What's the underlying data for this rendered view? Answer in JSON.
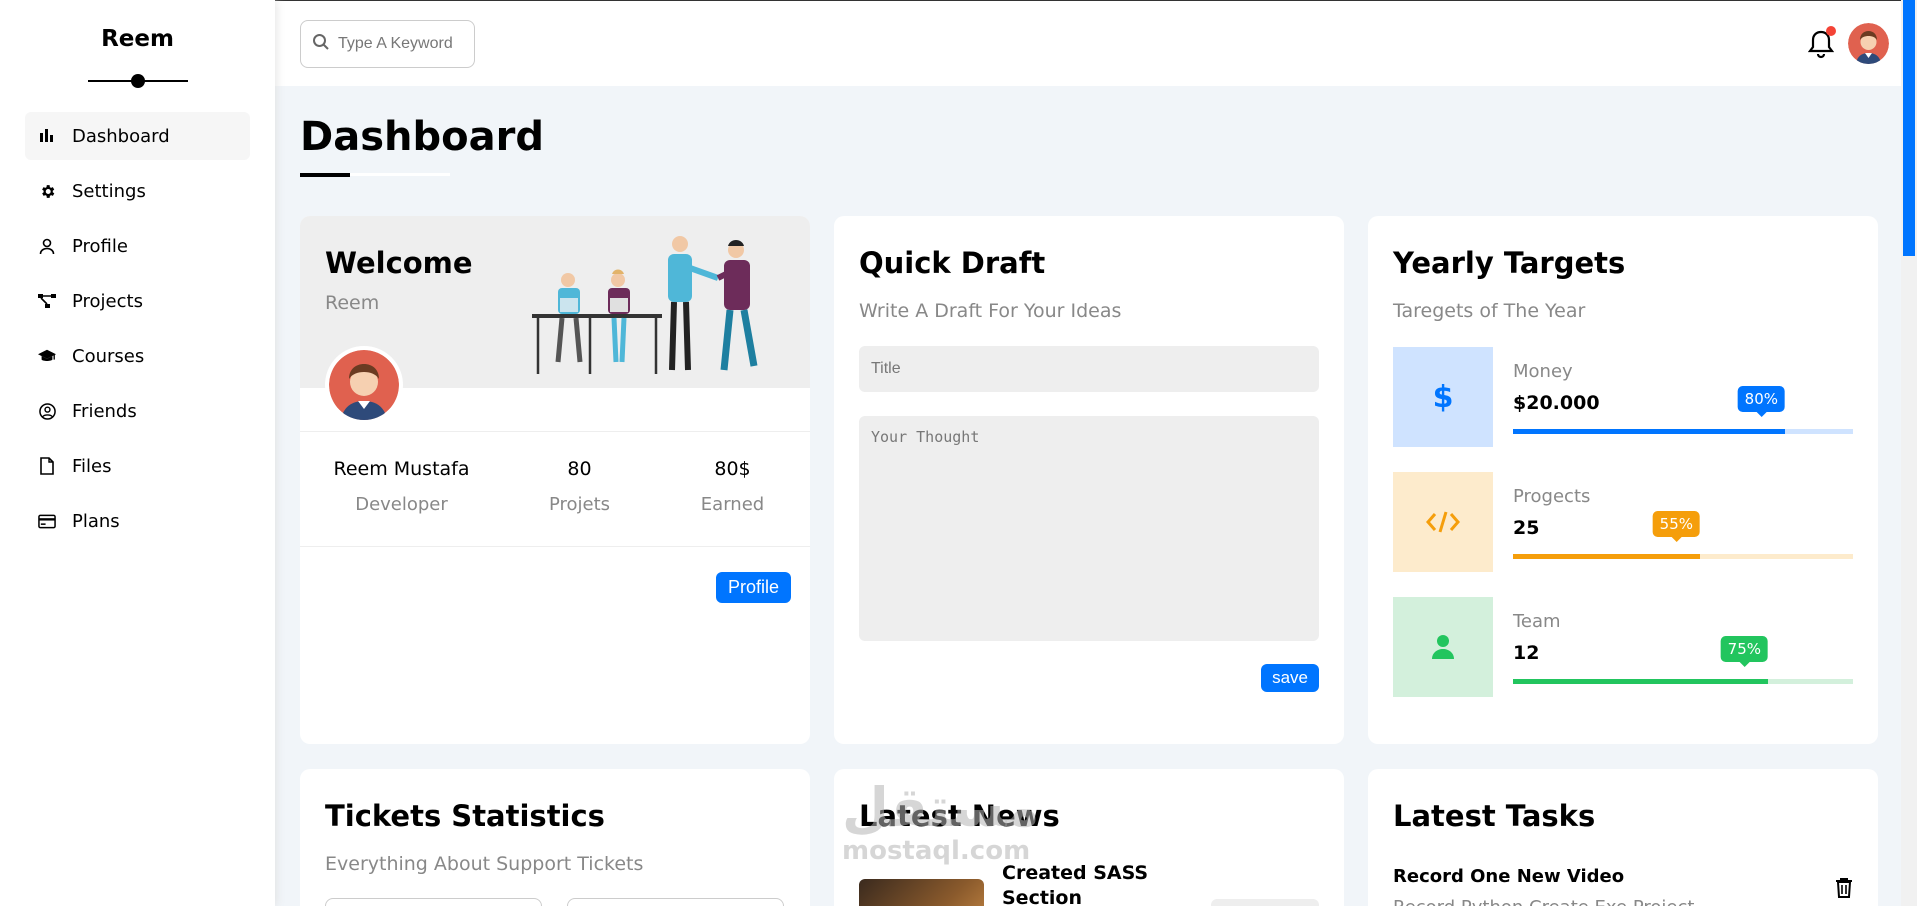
{
  "sidebar": {
    "brand": "Reem",
    "items": [
      {
        "label": "Dashboard",
        "icon": "chart-bar-icon",
        "active": true
      },
      {
        "label": "Settings",
        "icon": "gear-icon"
      },
      {
        "label": "Profile",
        "icon": "user-icon"
      },
      {
        "label": "Projects",
        "icon": "diagram-icon"
      },
      {
        "label": "Courses",
        "icon": "graduation-cap-icon"
      },
      {
        "label": "Friends",
        "icon": "user-circle-icon"
      },
      {
        "label": "Files",
        "icon": "file-icon"
      },
      {
        "label": "Plans",
        "icon": "credit-card-icon"
      }
    ]
  },
  "header": {
    "search_placeholder": "Type A Keyword"
  },
  "page": {
    "title": "Dashboard"
  },
  "welcome": {
    "title": "Welcome",
    "subtitle": "Reem",
    "stats": [
      {
        "value": "Reem Mustafa",
        "label": "Developer"
      },
      {
        "value": "80",
        "label": "Projets"
      },
      {
        "value": "80$",
        "label": "Earned"
      }
    ],
    "button": "Profile"
  },
  "quick_draft": {
    "title": "Quick Draft",
    "subtitle": "Write A Draft For Your Ideas",
    "title_placeholder": "Title",
    "thought_placeholder": "Your Thought",
    "button": "save"
  },
  "yearly_targets": {
    "title": "Yearly Targets",
    "subtitle": "Taregets of The Year",
    "targets": [
      {
        "label": "Money",
        "value": "$20.000",
        "percent": 80,
        "badge": "80%",
        "icon": "dollar-icon",
        "color": "#0075ff",
        "bg": "#cfe3ff",
        "track": "#cfe3ff"
      },
      {
        "label": "Progects",
        "value": "25",
        "percent": 55,
        "badge": "55%",
        "icon": "code-icon",
        "color": "#f59e0b",
        "bg": "#fdebcc",
        "track": "#fdebcc"
      },
      {
        "label": "Team",
        "value": "12",
        "percent": 75,
        "badge": "75%",
        "icon": "user-icon",
        "color": "#22c55e",
        "bg": "#d3f0dc",
        "track": "#d3f0dc"
      }
    ]
  },
  "tickets": {
    "title": "Tickets Statistics",
    "subtitle": "Everything About Support Tickets"
  },
  "news": {
    "title": "Latest News",
    "item_title": "Created SASS Section"
  },
  "tasks": {
    "title": "Latest Tasks",
    "task_title": "Record One New Video",
    "task_desc": "Record Python Create Exe Project"
  },
  "watermark": {
    "arabic": "مستقل",
    "latin": "mostaql.com"
  }
}
